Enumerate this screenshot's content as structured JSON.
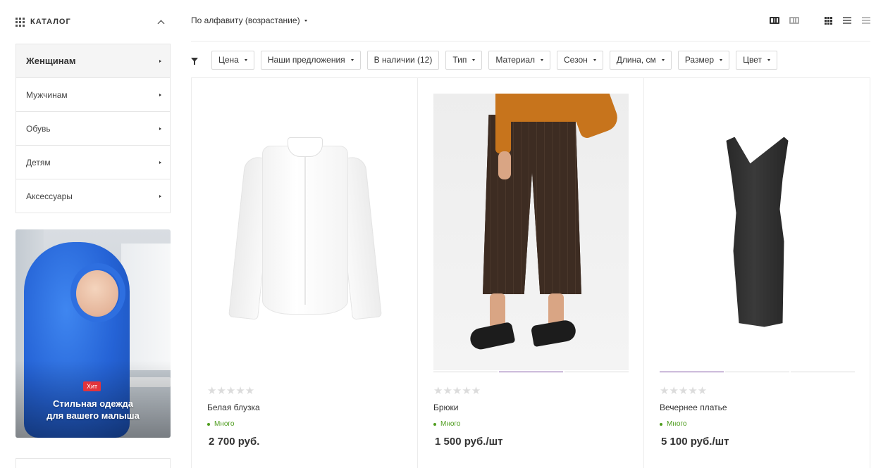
{
  "sidebar": {
    "catalog_title": "КАТАЛОГ",
    "items": [
      {
        "label": "Женщинам"
      },
      {
        "label": "Мужчинам"
      },
      {
        "label": "Обувь"
      },
      {
        "label": "Детям"
      },
      {
        "label": "Аксессуары"
      }
    ],
    "banner": {
      "badge": "Хит",
      "line1": "Стильная одежда",
      "line2": "для вашего малыша"
    }
  },
  "toolbar": {
    "sort_label": "По алфавиту (возрастание)"
  },
  "filters": [
    {
      "label": "Цена",
      "dropdown": true
    },
    {
      "label": "Наши предложения",
      "dropdown": true
    },
    {
      "label": "В наличии (12)",
      "dropdown": false
    },
    {
      "label": "Тип",
      "dropdown": true
    },
    {
      "label": "Материал",
      "dropdown": true
    },
    {
      "label": "Сезон",
      "dropdown": true
    },
    {
      "label": "Длина, см",
      "dropdown": true
    },
    {
      "label": "Размер",
      "dropdown": true
    },
    {
      "label": "Цвет",
      "dropdown": true
    }
  ],
  "products": [
    {
      "name": "Белая блузка",
      "stock": "Много",
      "price": "2 700 руб.",
      "rating": 0,
      "stars": "★★★★★"
    },
    {
      "name": "Брюки",
      "stock": "Много",
      "price": "1 500 руб./шт",
      "rating": 0,
      "stars": "★★★★★"
    },
    {
      "name": "Вечернее платье",
      "stock": "Много",
      "price": "5 100 руб./шт",
      "rating": 0,
      "stars": "★★★★★"
    }
  ],
  "colors": {
    "accent": "#7a4ca0",
    "stock_green": "#4f9d1f",
    "badge_red": "#e2343c"
  }
}
